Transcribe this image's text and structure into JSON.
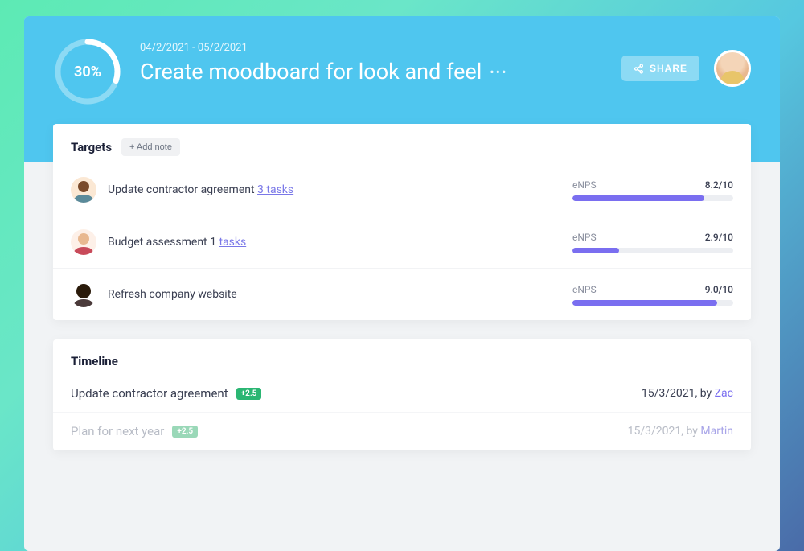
{
  "header": {
    "progress_percent": "30%",
    "progress_value": 30,
    "date_range": "04/2/2021 - 05/2/2021",
    "title": "Create moodboard for look and feel",
    "share_label": "SHARE"
  },
  "targets": {
    "title": "Targets",
    "add_note_label": "+ Add note",
    "metric_label": "eNPS",
    "items": [
      {
        "title": "Update contractor agreement ",
        "tasks_text": "3 tasks",
        "score": "8.2/10",
        "pct": 82
      },
      {
        "title": "Budget assessment 1 ",
        "tasks_text": "tasks",
        "score": "2.9/10",
        "pct": 29
      },
      {
        "title": "Refresh company website",
        "tasks_text": "",
        "score": "9.0/10",
        "pct": 90
      }
    ]
  },
  "timeline": {
    "title": "Timeline",
    "by_label": ", by ",
    "items": [
      {
        "title": "Update contractor agreement",
        "delta": "+2.5",
        "date": "15/3/2021",
        "user": "Zac",
        "faded": false
      },
      {
        "title": "Plan for next year",
        "delta": "+2.5",
        "date": "15/3/2021",
        "user": "Martin",
        "faded": true
      }
    ]
  }
}
